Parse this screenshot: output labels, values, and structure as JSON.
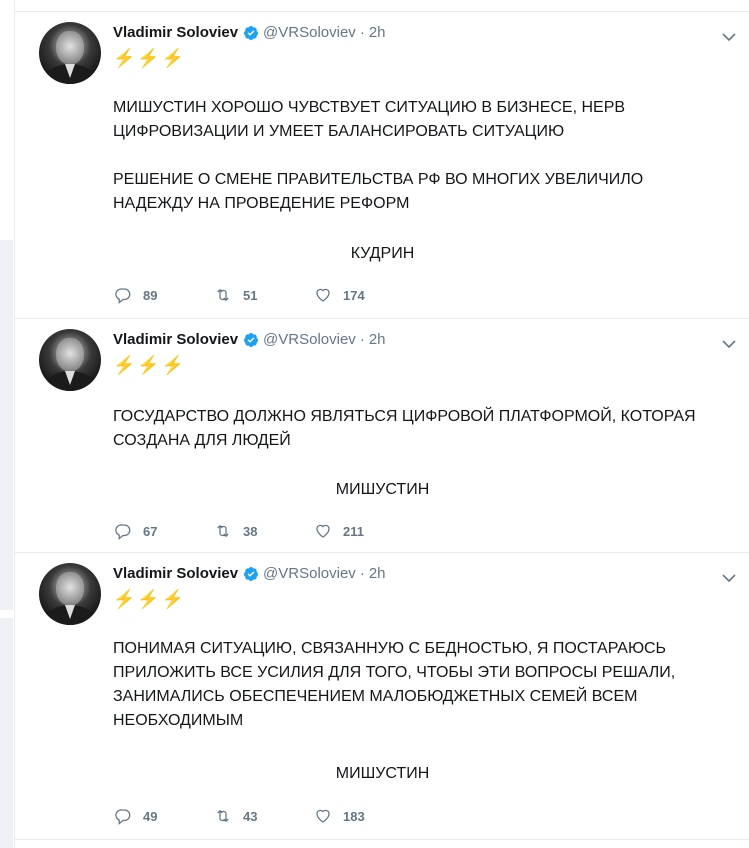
{
  "tweets": [
    {
      "author": "Vladimir Soloviev",
      "handle": "@VRSoloviev",
      "dot": "·",
      "time": "2h",
      "emoji": "⚡⚡⚡",
      "paragraphs": [
        "МИШУСТИН ХОРОШО ЧУВСТВУЕТ СИТУАЦИЮ В БИЗНЕСЕ, НЕРВ ЦИФРОВИЗАЦИИ И УМЕЕТ БАЛАНСИРОВАТЬ СИТУАЦИЮ",
        "РЕШЕНИЕ О СМЕНЕ ПРАВИТЕЛЬСТВА РФ ВО МНОГИХ УВЕЛИЧИЛО НАДЕЖДУ НА ПРОВЕДЕНИЕ РЕФОРМ"
      ],
      "signature": "КУДРИН",
      "replies": "89",
      "retweets": "51",
      "likes": "174"
    },
    {
      "author": "Vladimir Soloviev",
      "handle": "@VRSoloviev",
      "dot": "·",
      "time": "2h",
      "emoji": "⚡⚡⚡",
      "paragraphs": [
        "ГОСУДАРСТВО ДОЛЖНО ЯВЛЯТЬСЯ ЦИФРОВОЙ ПЛАТФОРМОЙ, КОТОРАЯ СОЗДАНА ДЛЯ ЛЮДЕЙ"
      ],
      "signature": "МИШУСТИН",
      "replies": "67",
      "retweets": "38",
      "likes": "211"
    },
    {
      "author": "Vladimir Soloviev",
      "handle": "@VRSoloviev",
      "dot": "·",
      "time": "2h",
      "emoji": "⚡⚡⚡",
      "paragraphs": [
        "ПОНИМАЯ СИТУАЦИЮ, СВЯЗАННУЮ С БЕДНОСТЬЮ, Я ПОСТАРАЮСЬ ПРИЛОЖИТЬ ВСЕ УСИЛИЯ ДЛЯ ТОГО, ЧТОБЫ ЭТИ ВОПРОСЫ РЕШАЛИ, ЗАНИМАЛИСЬ ОБЕСПЕЧЕНИЕМ МАЛОБЮДЖЕТНЫХ СЕМЕЙ ВСЕМ НЕОБХОДИМЫМ"
      ],
      "signature": "МИШУСТИН",
      "replies": "49",
      "retweets": "43",
      "likes": "183"
    }
  ],
  "icons": {
    "verified": "verified-badge-icon",
    "menu": "chevron-down-icon",
    "reply": "reply-icon",
    "retweet": "retweet-icon",
    "like": "heart-icon"
  },
  "colors": {
    "verified": "#1da1f2",
    "muted": "#657786",
    "bolt": "#f5a623",
    "divider": "#e6ecf0"
  }
}
